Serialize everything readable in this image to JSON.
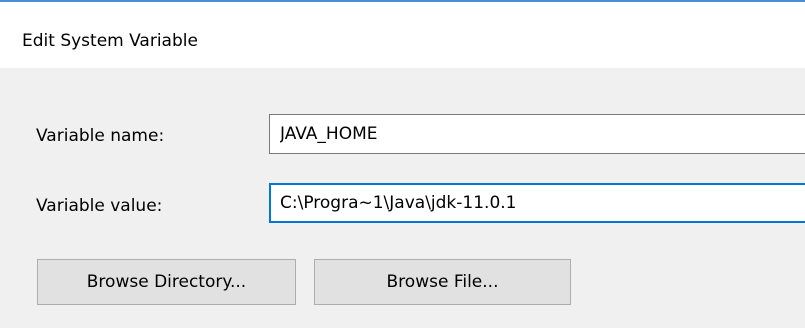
{
  "dialog": {
    "title": "Edit System Variable",
    "accent_color": "#0078d7"
  },
  "fields": {
    "variable_name": {
      "label": "Variable name:",
      "value": "JAVA_HOME"
    },
    "variable_value": {
      "label": "Variable value:",
      "value": "C:\\Progra~1\\Java\\jdk-11.0.1"
    }
  },
  "buttons": {
    "browse_directory": "Browse Directory...",
    "browse_file": "Browse File..."
  }
}
